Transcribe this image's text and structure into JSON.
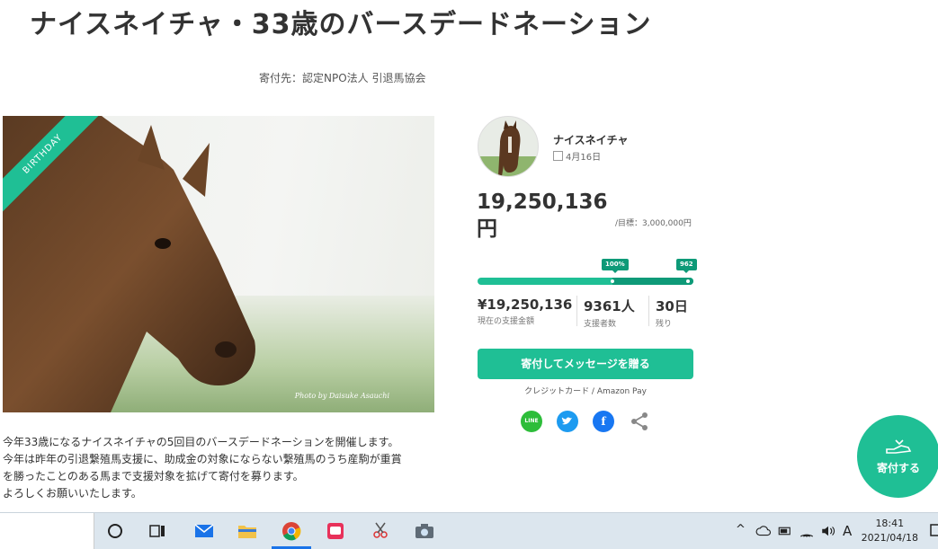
{
  "page": {
    "title": "ナイスネイチャ・33歳のバースデードネーション",
    "recipient": "寄付先：認定NPO法人 引退馬協会"
  },
  "hero": {
    "ribbon": "BIRTHDAY",
    "photo_credit": "Photo by Daisuke Asauchi"
  },
  "description": [
    "今年33歳になるナイスネイチャの5回目のバースデードネーションを開催します。",
    "今年は昨年の引退繋殖馬支援に、助成金の対象にならない繋殖馬のうち産駒が重賞",
    "を勝ったことのある馬まで支援対象を拡げて寄付を募ります。",
    "よろしくお願いいたします。"
  ],
  "owner": {
    "name": "ナイスネイチャ",
    "date": "4月16日"
  },
  "funding": {
    "amount": "19,250,136円",
    "goal": "/目標：3,000,000円",
    "progress_label_1": "100%",
    "progress_label_2": "962",
    "progress_percent": 962,
    "stats": [
      {
        "value": "¥19,250,136",
        "label": "現在の支援金額"
      },
      {
        "value": "9361人",
        "label": "支援者数"
      },
      {
        "value": "30日",
        "label": "残り"
      }
    ]
  },
  "actions": {
    "donate_button": "寄付してメッセージを贈る",
    "payment_note": "クレジットカード / Amazon Pay",
    "share_line": "LINE",
    "float_button": "寄付する"
  },
  "taskbar": {
    "ime": "A",
    "time": "18:41",
    "date": "2021/04/18"
  },
  "colors": {
    "accent": "#1fbf95",
    "accent_dark": "#0e9a78"
  }
}
